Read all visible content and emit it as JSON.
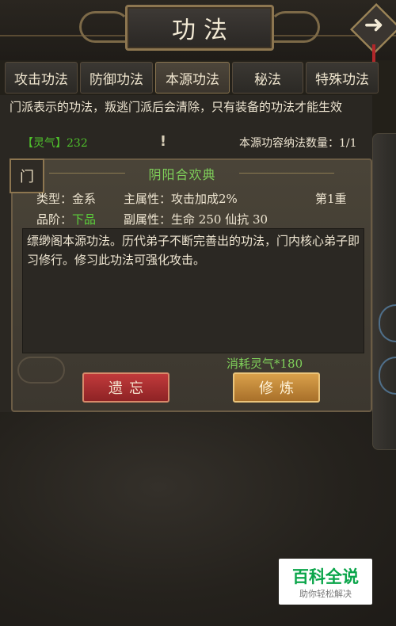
{
  "header": {
    "title": "功法",
    "next_icon": "arrow-right-icon"
  },
  "tabs": [
    {
      "label": "攻击功法",
      "active": false
    },
    {
      "label": "防御功法",
      "active": false
    },
    {
      "label": "本源功法",
      "active": true
    },
    {
      "label": "秘法",
      "active": false
    },
    {
      "label": "特殊功法",
      "active": false
    }
  ],
  "info": {
    "description": "门派表示的功法，叛逃门派后会清除，只有装备的功法才能生效",
    "qi_label": "【灵气】232",
    "warning_mark": "!",
    "capacity": "本源功容纳法数量：1/1"
  },
  "card": {
    "tag": "门",
    "name": "阴阳合欢典",
    "type_label": "类型：",
    "type_value": "金系",
    "main_attr_label": "主属性：",
    "main_attr_value": "攻击加成2%",
    "level": "第1重",
    "grade_label": "品阶：",
    "grade_value": "下品",
    "sub_attr_label": "副属性：",
    "sub_attr_value": "生命 250 仙抗 30",
    "desc": "缥缈阁本源功法。历代弟子不断完善出的功法，门内核心弟子即习修行。修习此功法可强化攻击。",
    "cost": "消耗灵气*180",
    "forget_button": "遗忘",
    "train_button": "修炼"
  },
  "watermark": {
    "title": "百科全说",
    "subtitle": "助你轻松解决"
  },
  "colors": {
    "green_text": "#5cd03b",
    "forget_red": "#b3302f",
    "train_gold": "#c98d3c"
  }
}
